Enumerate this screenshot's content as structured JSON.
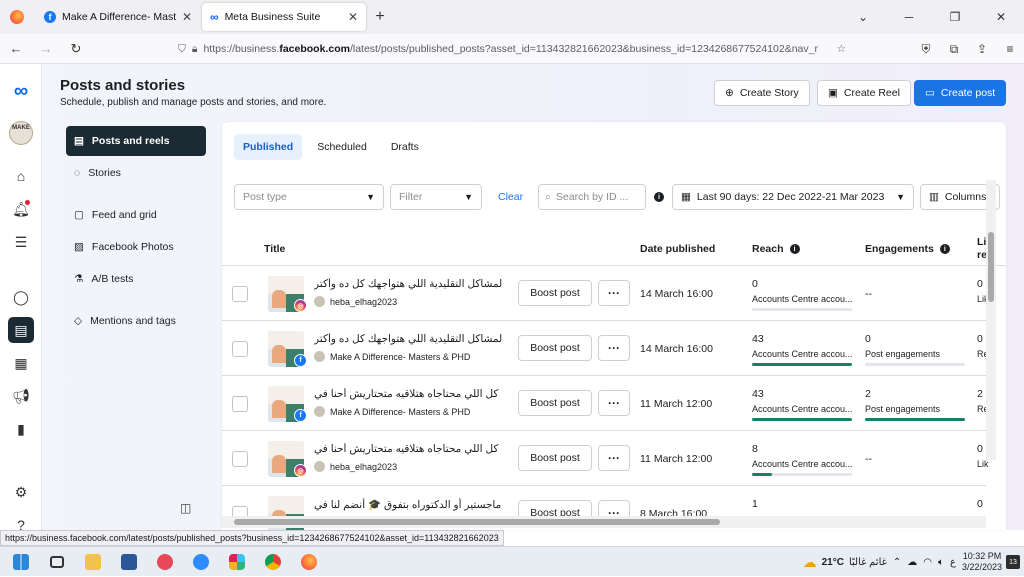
{
  "browser": {
    "tabs": [
      {
        "title": "Make A Difference- Masters & P",
        "favicon": "facebook-icon"
      },
      {
        "title": "Meta Business Suite",
        "favicon": "meta-icon"
      }
    ],
    "url_prefix": "https://business.",
    "url_domain": "facebook.com",
    "url_rest": "/latest/posts/published_posts?asset_id=113432821662023&business_id=1234268677524102&nav_r",
    "status_url": "https://business.facebook.com/latest/posts/published_posts?business_id=1234268677524102&asset_id=113432821662023"
  },
  "header": {
    "title": "Posts and stories",
    "subtitle": "Schedule, publish and manage posts and stories, and more.",
    "create_story": "Create Story",
    "create_reel": "Create Reel",
    "create_post": "Create post"
  },
  "rail": {
    "logo_text": "MAKE"
  },
  "leftnav": {
    "items": [
      {
        "label": "Posts and reels"
      },
      {
        "label": "Stories"
      },
      {
        "label": "Feed and grid"
      },
      {
        "label": "Facebook Photos"
      },
      {
        "label": "A/B tests"
      },
      {
        "label": "Mentions and tags"
      }
    ]
  },
  "tabs": [
    "Published",
    "Scheduled",
    "Drafts"
  ],
  "filters": {
    "post_type_placeholder": "Post type",
    "filter_placeholder": "Filter",
    "clear": "Clear",
    "search_placeholder": "Search by ID ...",
    "date_range": "Last 90 days: 22 Dec 2022-21 Mar 2023",
    "columns": "Columns"
  },
  "table": {
    "headers": {
      "title": "Title",
      "date": "Date published",
      "reach": "Reach",
      "engagements": "Engagements",
      "cut": "Li re"
    },
    "rows": [
      {
        "text": "لمشاكل التقليدية اللي هتواجهك كل ده وأكتر",
        "account": "heba_elhag2023",
        "platform": "instagram",
        "boost": "Boost post",
        "date": "14 March 16:00",
        "reach": "0",
        "reach_label": "Accounts Centre accou...",
        "reach_fill": 0,
        "eng_value": "--",
        "eng_label": "",
        "eng_fill": null,
        "cut_value": "0",
        "cut_label": "Lik"
      },
      {
        "text": "لمشاكل التقليدية اللي هتواجهك كل ده وأكتر",
        "account": "Make A Difference- Masters & PHD",
        "platform": "facebook",
        "boost": "Boost post",
        "date": "14 March 16:00",
        "reach": "43",
        "reach_label": "Accounts Centre accou...",
        "reach_fill": 1,
        "eng_value": "0",
        "eng_label": "Post engagements",
        "eng_fill": 0,
        "cut_value": "0",
        "cut_label": "Re"
      },
      {
        "text": "كل اللي محتاجاه هتلاقيه متحتاريش أحنا في",
        "account": "Make A Difference- Masters & PHD",
        "platform": "facebook",
        "boost": "Boost post",
        "date": "11 March 12:00",
        "reach": "43",
        "reach_label": "Accounts Centre accou...",
        "reach_fill": 1,
        "eng_value": "2",
        "eng_label": "Post engagements",
        "eng_fill": 1,
        "cut_value": "2",
        "cut_label": "Re"
      },
      {
        "text": "كل اللي محتاجاه هتلاقيه متحتاريش أحنا في",
        "account": "heba_elhag2023",
        "platform": "instagram",
        "boost": "Boost post",
        "date": "11 March 12:00",
        "reach": "8",
        "reach_label": "Accounts Centre accou...",
        "reach_fill": 0.2,
        "eng_value": "--",
        "eng_label": "",
        "eng_fill": null,
        "cut_value": "0",
        "cut_label": "Lik"
      },
      {
        "text": "ماجستير أو الدكتوراه بتفوق 🎓 أنضم لنا في",
        "account": "",
        "platform": "",
        "boost": "Boost post",
        "date": "8 March 16:00",
        "reach": "1",
        "reach_label": "",
        "reach_fill": null,
        "eng_value": "",
        "eng_label": "",
        "eng_fill": null,
        "cut_value": "0",
        "cut_label": ""
      }
    ]
  },
  "taskbar": {
    "temperature": "21°C",
    "weather_text": "غائم غالبًا",
    "lang": "ع",
    "time": "10:32 PM",
    "date": "3/22/2023",
    "notifications": "13"
  },
  "colors": {
    "accent": "#1b74e4",
    "metric_bar": "#1a7f64",
    "nav_active": "#1c2b33"
  }
}
